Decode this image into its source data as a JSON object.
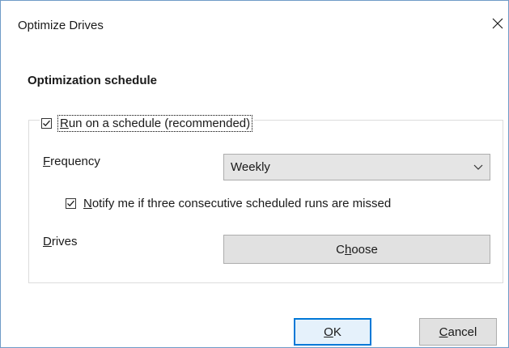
{
  "window": {
    "title": "Optimize Drives",
    "close_icon": "close-icon"
  },
  "schedule": {
    "heading": "Optimization schedule",
    "run_on_schedule": {
      "label_mnemonic": "R",
      "label_rest": "un on a schedule (recommended)",
      "checked": true
    },
    "frequency": {
      "label_mnemonic": "F",
      "label_rest": "requency",
      "selected": "Weekly",
      "dropdown_icon": "chevron-down-icon"
    },
    "notify": {
      "label_mnemonic": "N",
      "label_rest": "otify me if three consecutive scheduled runs are missed",
      "checked": true
    },
    "drives": {
      "label_mnemonic": "D",
      "label_rest": "rives",
      "button_pre": "C",
      "button_mnemonic": "h",
      "button_post": "oose"
    }
  },
  "footer": {
    "ok_mnemonic": "O",
    "ok_rest": "K",
    "cancel_mnemonic": "C",
    "cancel_rest": "ancel"
  },
  "colors": {
    "accent": "#0078d7",
    "border": "#6f9bc7"
  }
}
